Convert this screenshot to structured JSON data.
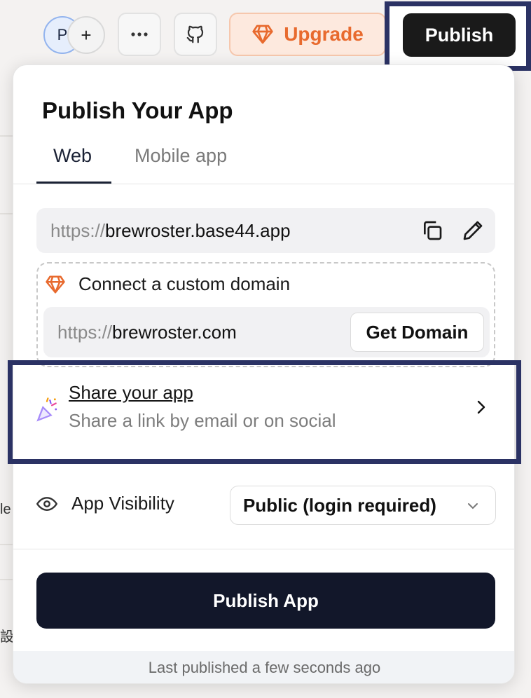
{
  "topbar": {
    "avatar_initial": "P",
    "add_symbol": "+",
    "more_symbol": "•••",
    "upgrade_label": "Upgrade",
    "publish_label": "Publish"
  },
  "background": {
    "fragment_1": "le",
    "fragment_2": "設"
  },
  "popover": {
    "title": "Publish Your App",
    "tabs": [
      {
        "label": "Web",
        "active": true
      },
      {
        "label": "Mobile app",
        "active": false
      }
    ],
    "app_url": {
      "prefix": "https://",
      "domain": "brewroster.base44.app"
    },
    "custom_domain": {
      "heading": "Connect a custom domain",
      "prefix": "https://",
      "placeholder_domain": "brewroster.com",
      "button_label": "Get Domain"
    },
    "share": {
      "title": "Share your app",
      "subtitle": "Share a link by email or on social"
    },
    "visibility": {
      "label": "App Visibility",
      "selected": "Public (login required)"
    },
    "publish_button": "Publish App",
    "footer_status": "Last published a few seconds ago"
  },
  "colors": {
    "highlight": "#2b3264",
    "upgrade": "#e86a2e",
    "publish_dark": "#12172a"
  }
}
